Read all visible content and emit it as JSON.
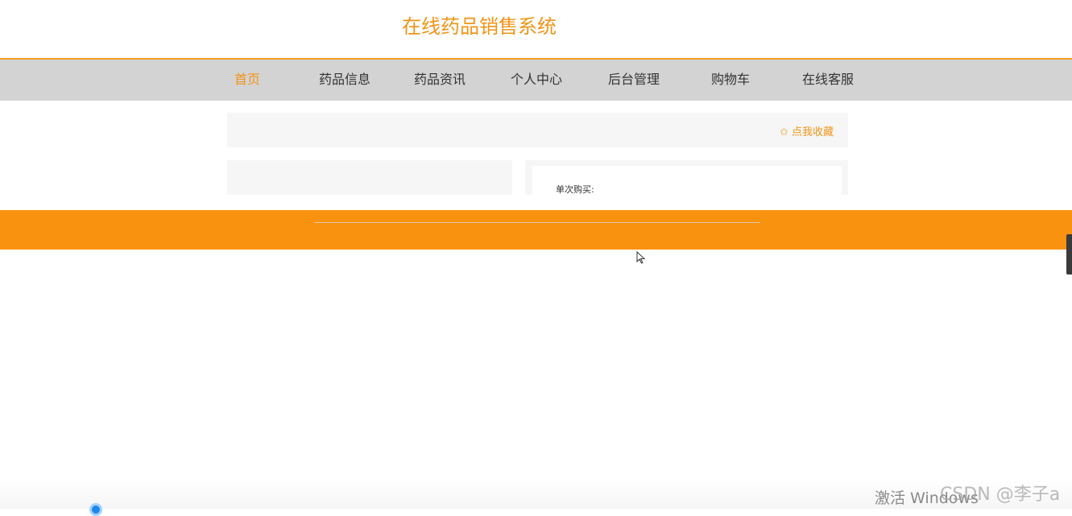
{
  "header": {
    "site_title": "在线药品销售系统"
  },
  "nav": {
    "items": [
      {
        "label": "首页"
      },
      {
        "label": "药品信息"
      },
      {
        "label": "药品资讯"
      },
      {
        "label": "个人中心"
      },
      {
        "label": "后台管理"
      },
      {
        "label": "购物车"
      },
      {
        "label": "在线客服"
      }
    ],
    "active_index": 0
  },
  "favorite": {
    "label": "✩ 点我收藏"
  },
  "product": {
    "buy_label": "单次购买:"
  },
  "overlay": {
    "activate_windows": "激活 Windows",
    "watermark": "CSDN @李子a"
  },
  "colors": {
    "accent": "#f29416",
    "footer": "#f9920e",
    "nav_bg": "#d3d3d3"
  }
}
